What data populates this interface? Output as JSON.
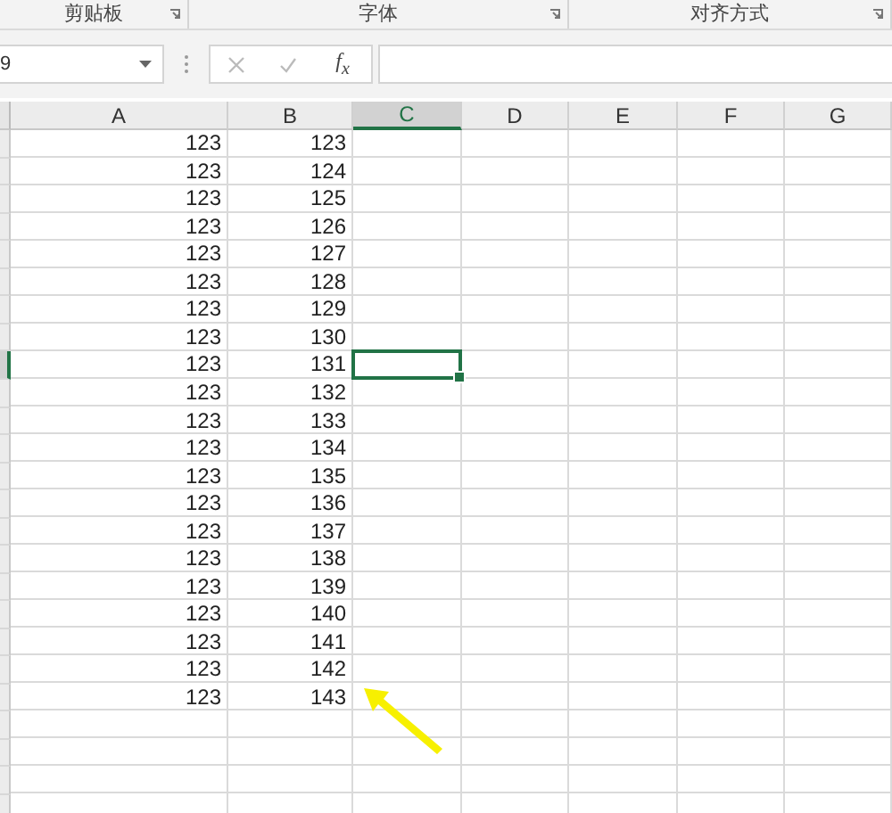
{
  "ribbon_groups": [
    {
      "label": "剪贴板",
      "launcher": true
    },
    {
      "label": "字体",
      "launcher": true
    },
    {
      "label": "对齐方式",
      "launcher": true
    }
  ],
  "name_box": {
    "value": "9"
  },
  "formula_bar": {
    "function_button": "f$_{x}$"
  },
  "columns": [
    {
      "label": "A",
      "selected": false
    },
    {
      "label": "B",
      "selected": false
    },
    {
      "label": "C",
      "selected": true
    },
    {
      "label": "D",
      "selected": false
    },
    {
      "label": "E",
      "selected": false
    },
    {
      "label": "F",
      "selected": false
    },
    {
      "label": "G",
      "selected": false
    }
  ],
  "rows": [
    {
      "values": [
        "123",
        "123"
      ],
      "selected": false
    },
    {
      "values": [
        "123",
        "124"
      ],
      "selected": false
    },
    {
      "values": [
        "123",
        "125"
      ],
      "selected": false
    },
    {
      "values": [
        "123",
        "126"
      ],
      "selected": false
    },
    {
      "values": [
        "123",
        "127"
      ],
      "selected": false
    },
    {
      "values": [
        "123",
        "128"
      ],
      "selected": false
    },
    {
      "values": [
        "123",
        "129"
      ],
      "selected": false
    },
    {
      "values": [
        "123",
        "130"
      ],
      "selected": false
    },
    {
      "values": [
        "123",
        "131"
      ],
      "selected": true
    },
    {
      "values": [
        "123",
        "132"
      ],
      "selected": false
    },
    {
      "values": [
        "123",
        "133"
      ],
      "selected": false
    },
    {
      "values": [
        "123",
        "134"
      ],
      "selected": false
    },
    {
      "values": [
        "123",
        "135"
      ],
      "selected": false
    },
    {
      "values": [
        "123",
        "136"
      ],
      "selected": false
    },
    {
      "values": [
        "123",
        "137"
      ],
      "selected": false
    },
    {
      "values": [
        "123",
        "138"
      ],
      "selected": false
    },
    {
      "values": [
        "123",
        "139"
      ],
      "selected": false
    },
    {
      "values": [
        "123",
        "140"
      ],
      "selected": false
    },
    {
      "values": [
        "123",
        "141"
      ],
      "selected": false
    },
    {
      "values": [
        "123",
        "142"
      ],
      "selected": false
    },
    {
      "values": [
        "123",
        "143"
      ],
      "selected": false
    }
  ]
}
